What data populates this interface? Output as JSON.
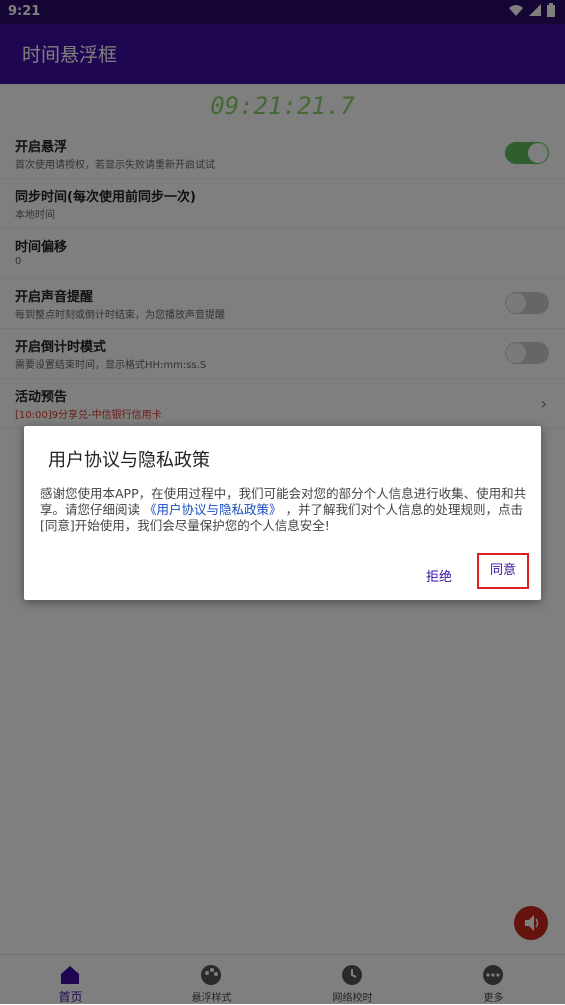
{
  "status_bar": {
    "time": "9:21"
  },
  "app_bar": {
    "title": "时间悬浮框"
  },
  "clock": {
    "value": "09:21:21.7"
  },
  "settings": [
    {
      "title": "开启悬浮",
      "subtitle": "首次使用请授权，若显示失败请重新开启试试",
      "toggle": "on"
    },
    {
      "title": "同步时间(每次使用前同步一次)",
      "subtitle": "本地时间"
    },
    {
      "title": "时间偏移",
      "subtitle": "0"
    },
    {
      "title": "开启声音提醒",
      "subtitle": "每到整点时刻或倒计时结束，为您播放声音提醒",
      "toggle": "off"
    },
    {
      "title": "开启倒计时模式",
      "subtitle": "需要设置结束时间，显示格式HH:mm:ss.S",
      "toggle": "off"
    },
    {
      "title": "活动预告",
      "subtitle": "[10:00]9分享兑-中信银行信用卡"
    }
  ],
  "dialog": {
    "title": "用户协议与隐私政策",
    "body_before": "感谢您使用本APP，在使用过程中，我们可能会对您的部分个人信息进行收集、使用和共享。请您仔细阅读",
    "link": "《用户协议与隐私政策》",
    "body_after": "，并了解我们对个人信息的处理规则，点击[同意]开始使用，我们会尽量保护您的个人信息安全!",
    "reject_label": "拒绝",
    "agree_label": "同意"
  },
  "bottom_nav": [
    {
      "label": "首页",
      "icon": "home-icon",
      "active": true
    },
    {
      "label": "悬浮样式",
      "icon": "palette-icon"
    },
    {
      "label": "网络校时",
      "icon": "clock-icon"
    },
    {
      "label": "更多",
      "icon": "more-icon"
    }
  ],
  "colors": {
    "primary": "#3d0fa0",
    "status_bar": "#2a0a6a",
    "clock": "#8bd36d",
    "toggle_on": "#5fbf5f",
    "highlight": "#e02020",
    "fab": "#c9271a"
  }
}
